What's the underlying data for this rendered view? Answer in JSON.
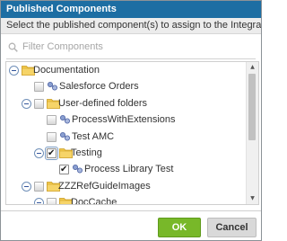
{
  "dialog": {
    "title": "Published Components",
    "instruction": "Select the published component(s) to assign to the Integration Pack"
  },
  "filter": {
    "placeholder": "Filter Components",
    "value": ""
  },
  "tree": [
    {
      "label": "Documentation",
      "type": "folder",
      "depth": 0,
      "expanded": true,
      "checkbox": false,
      "checked": false
    },
    {
      "label": "Salesforce Orders",
      "type": "component",
      "depth": 1,
      "expanded": false,
      "checkbox": true,
      "checked": false
    },
    {
      "label": "User-defined folders",
      "type": "folder",
      "depth": 1,
      "expanded": true,
      "checkbox": true,
      "checked": false
    },
    {
      "label": "ProcessWithExtensions",
      "type": "component",
      "depth": 2,
      "expanded": false,
      "checkbox": true,
      "checked": false
    },
    {
      "label": "Test AMC",
      "type": "component",
      "depth": 2,
      "expanded": false,
      "checkbox": true,
      "checked": false
    },
    {
      "label": "Testing",
      "type": "folder",
      "depth": 2,
      "expanded": true,
      "checkbox": true,
      "checked": true
    },
    {
      "label": "Process Library Test",
      "type": "component",
      "depth": 3,
      "expanded": false,
      "checkbox": true,
      "checked": true
    },
    {
      "label": "ZZZRefGuideImages",
      "type": "folder",
      "depth": 1,
      "expanded": true,
      "checkbox": true,
      "checked": false
    },
    {
      "label": "DocCache",
      "type": "folder",
      "depth": 2,
      "expanded": true,
      "checkbox": true,
      "checked": false
    }
  ],
  "buttons": {
    "ok": "OK",
    "cancel": "Cancel"
  },
  "icons": {
    "search": "search-icon",
    "folder": "folder-icon",
    "component": "process-component-icon",
    "collapse": "collapse-toggle-icon"
  },
  "colors": {
    "titlebar": "#1d6ea3",
    "ok_button": "#78b829",
    "cancel_button": "#d9d9d9",
    "folder": "#f2c94c"
  }
}
